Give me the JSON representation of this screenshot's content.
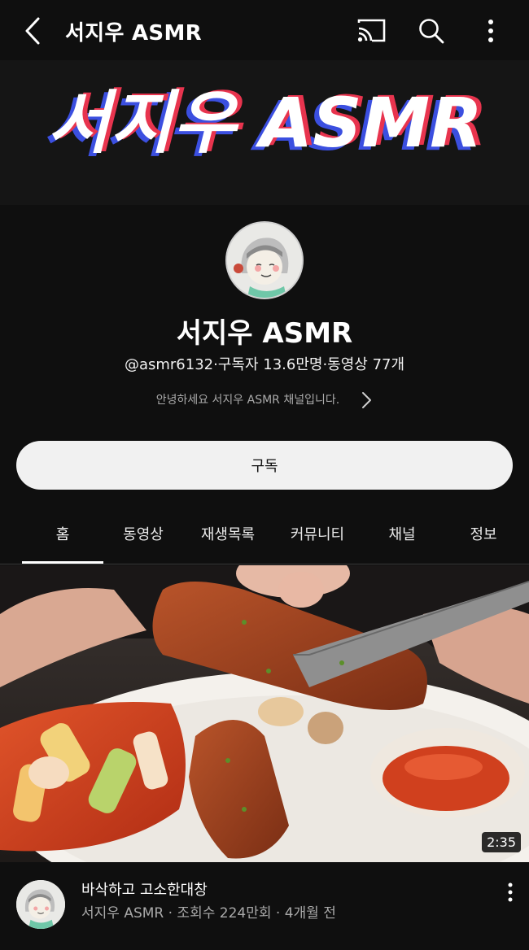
{
  "topbar": {
    "title": "서지우 ASMR",
    "icons": [
      "back-arrow-icon",
      "cast-icon",
      "search-icon",
      "more-vert-icon"
    ]
  },
  "banner": {
    "text": "서지우 ASMR",
    "colors": {
      "white": "#ffffff",
      "red": "#e8344e",
      "blue": "#3b4fe0"
    }
  },
  "channel": {
    "name": "서지우 ASMR",
    "meta": "@asmr6132·구독자 13.6만명·동영상 77개",
    "description": "안녕하세요 서지우 ASMR 채널입니다.",
    "subscribe_label": "구독"
  },
  "tabs": [
    {
      "label": "홈",
      "active": true
    },
    {
      "label": "동영상",
      "active": false
    },
    {
      "label": "재생목록",
      "active": false
    },
    {
      "label": "커뮤니티",
      "active": false
    },
    {
      "label": "채널",
      "active": false
    },
    {
      "label": "정보",
      "active": false
    }
  ],
  "video": {
    "title": "바삭하고 고소한대창",
    "meta": "서지우 ASMR · 조회수 224만회 · 4개월 전",
    "duration": "2:35"
  }
}
